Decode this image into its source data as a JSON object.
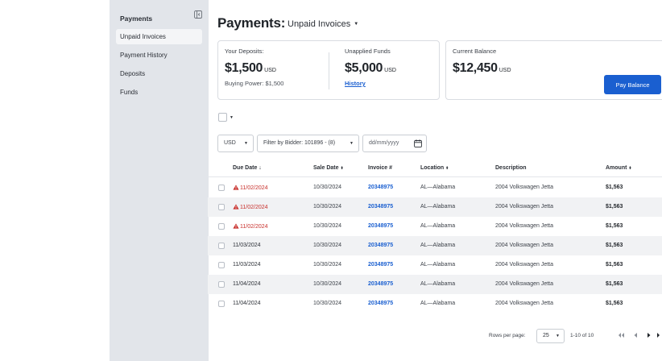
{
  "sidebar": {
    "title": "Payments",
    "items": [
      {
        "label": "Unpaid Invoices",
        "active": true
      },
      {
        "label": "Payment History",
        "active": false
      },
      {
        "label": "Deposits",
        "active": false
      },
      {
        "label": "Funds",
        "active": false
      }
    ]
  },
  "header": {
    "title": "Payments:",
    "view": "Unpaid Invoices"
  },
  "deposits_card": {
    "your_deposits_label": "Your Deposits:",
    "your_deposits_value": "$1,500",
    "your_deposits_currency": "USD",
    "buying_power": "Buying Power: $1,500",
    "unapplied_label": "Unapplied Funds",
    "unapplied_value": "$5,000",
    "unapplied_currency": "USD",
    "history_link": "History"
  },
  "balance_card": {
    "label": "Current Balance",
    "value": "$12,450",
    "currency": "USD",
    "pay_button": "Pay Balance"
  },
  "filters": {
    "currency": "USD",
    "bidder": "Filter by Bidder: 101896 - (8)",
    "date_placeholder": "dd/mm/yyyy"
  },
  "table": {
    "columns": {
      "due_date": "Due Date",
      "sale_date": "Sale Date",
      "invoice": "Invoice #",
      "location": "Location",
      "description": "Description",
      "amount": "Amount"
    },
    "rows": [
      {
        "due": "11/02/2024",
        "overdue": true,
        "sale": "10/30/2024",
        "invoice": "20348975",
        "location": "AL—Alabama",
        "description": "2004 Volkswagen Jetta",
        "amount": "$1,563"
      },
      {
        "due": "11/02/2024",
        "overdue": true,
        "sale": "10/30/2024",
        "invoice": "20348975",
        "location": "AL—Alabama",
        "description": "2004 Volkswagen Jetta",
        "amount": "$1,563"
      },
      {
        "due": "11/02/2024",
        "overdue": true,
        "sale": "10/30/2024",
        "invoice": "20348975",
        "location": "AL—Alabama",
        "description": "2004 Volkswagen Jetta",
        "amount": "$1,563"
      },
      {
        "due": "11/03/2024",
        "overdue": false,
        "sale": "10/30/2024",
        "invoice": "20348975",
        "location": "AL—Alabama",
        "description": "2004 Volkswagen Jetta",
        "amount": "$1,563"
      },
      {
        "due": "11/03/2024",
        "overdue": false,
        "sale": "10/30/2024",
        "invoice": "20348975",
        "location": "AL—Alabama",
        "description": "2004 Volkswagen Jetta",
        "amount": "$1,563"
      },
      {
        "due": "11/04/2024",
        "overdue": false,
        "sale": "10/30/2024",
        "invoice": "20348975",
        "location": "AL—Alabama",
        "description": "2004 Volkswagen Jetta",
        "amount": "$1,563"
      },
      {
        "due": "11/04/2024",
        "overdue": false,
        "sale": "10/30/2024",
        "invoice": "20348975",
        "location": "AL—Alabama",
        "description": "2004 Volkswagen Jetta",
        "amount": "$1,563"
      }
    ]
  },
  "pagination": {
    "rows_per_page_label": "Rows per page:",
    "rows_per_page": "25",
    "range": "1-10 of 10"
  },
  "colors": {
    "accent": "#1a5fd0",
    "overdue": "#c8302c",
    "sidebar_bg": "#e2e5ea"
  }
}
